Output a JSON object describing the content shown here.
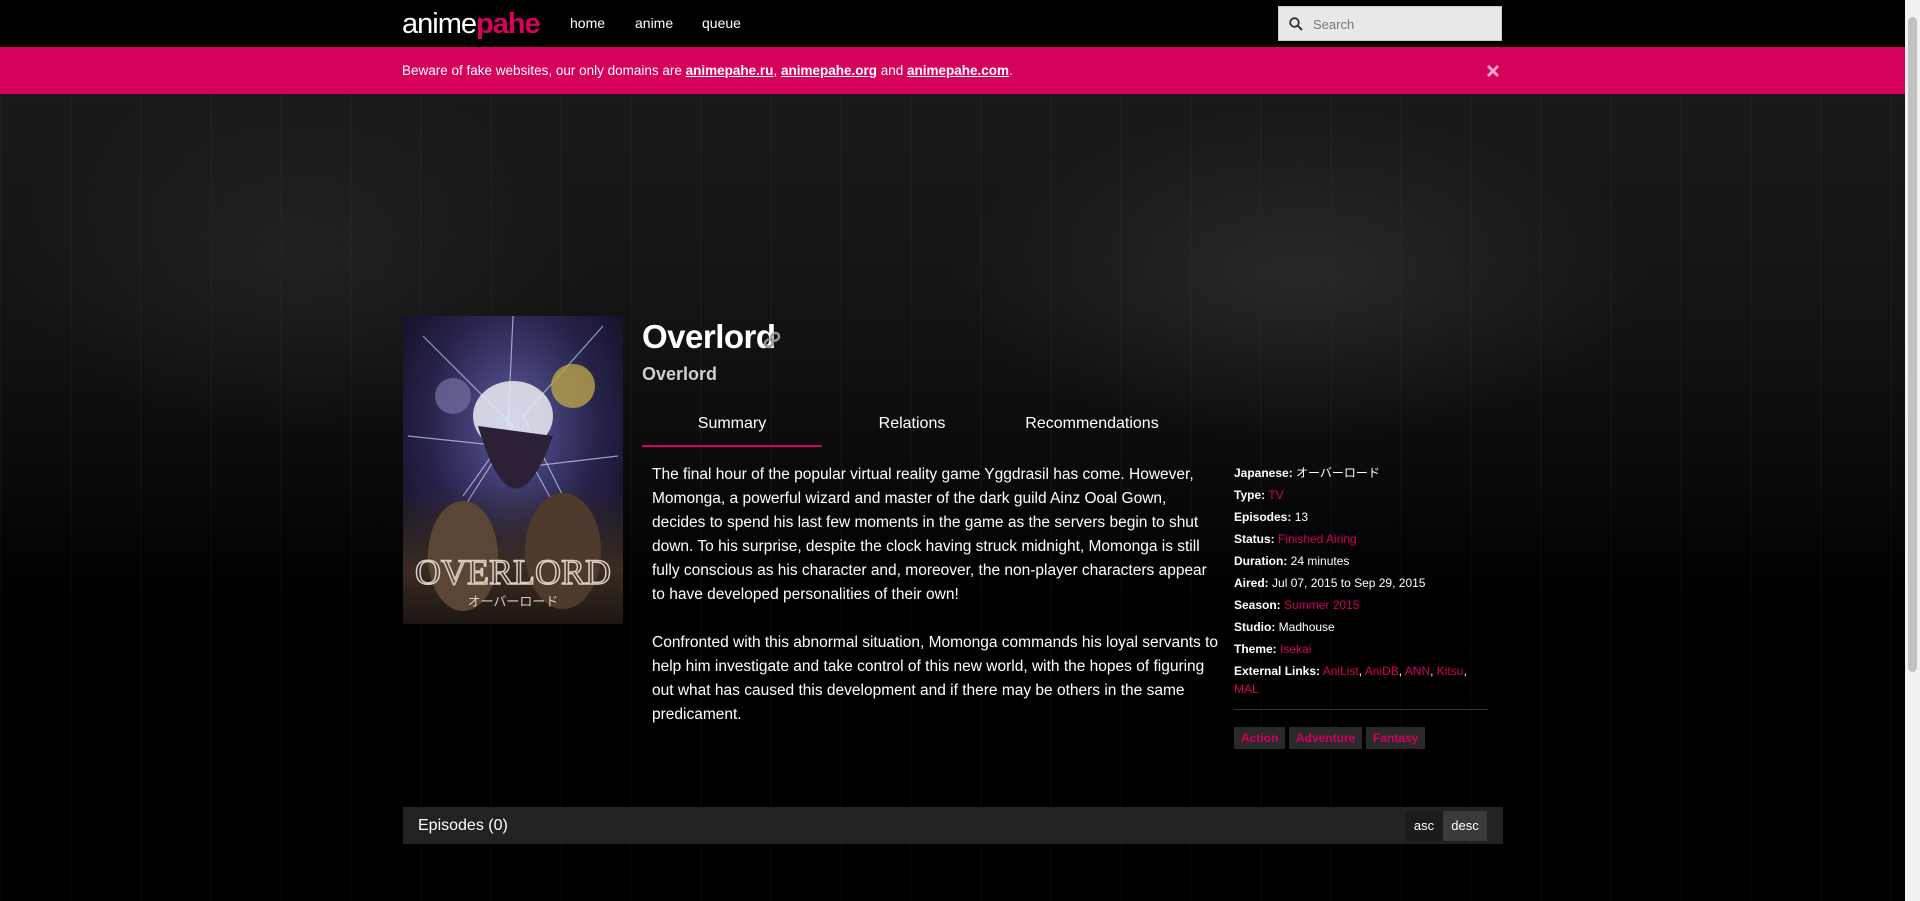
{
  "nav": {
    "logo_part1": "anime",
    "logo_part2": "pahe",
    "links": [
      "home",
      "anime",
      "queue"
    ],
    "search_placeholder": "Search"
  },
  "banner": {
    "text_before": "Beware of fake websites, our only domains are ",
    "domain1": "animepahe.ru",
    "sep1": ", ",
    "domain2": "animepahe.org",
    "sep2": " and ",
    "domain3": "animepahe.com",
    "text_after": "."
  },
  "poster": {
    "title_text": "OVERLORD",
    "subtitle_text": "オーバーロード"
  },
  "anime": {
    "title": "Overlord",
    "subtitle": "Overlord"
  },
  "tabs": [
    "Summary",
    "Relations",
    "Recommendations"
  ],
  "synopsis": [
    "The final hour of the popular virtual reality game Yggdrasil has come. However, Momonga, a powerful wizard and master of the dark guild Ainz Ooal Gown, decides to spend his last few moments in the game as the servers begin to shut down. To his surprise, despite the clock having struck midnight, Momonga is still fully conscious as his character and, moreover, the non-player characters appear to have developed personalities of their own!",
    "Confronted with this abnormal situation, Momonga commands his loyal servants to help him investigate and take control of this new world, with the hopes of figuring out what has caused this development and if there may be others in the same predicament."
  ],
  "info": {
    "japanese_label": "Japanese:",
    "japanese": "オーバーロード",
    "type_label": "Type:",
    "type": "TV",
    "episodes_label": "Episodes:",
    "episodes": "13",
    "status_label": "Status:",
    "status": "Finished Airing",
    "duration_label": "Duration:",
    "duration": "24 minutes",
    "aired_label": "Aired:",
    "aired": "Jul 07, 2015 to Sep 29, 2015",
    "season_label": "Season:",
    "season": "Summer 2015",
    "studio_label": "Studio:",
    "studio": "Madhouse",
    "theme_label": "Theme:",
    "theme": "Isekai",
    "external_label": "External Links:",
    "external_links": [
      "AniList",
      "AniDB",
      "ANN",
      "Kitsu",
      "MAL"
    ]
  },
  "genres": [
    "Action",
    "Adventure",
    "Fantasy"
  ],
  "episodes": {
    "title": "Episodes (0)",
    "sort_asc": "asc",
    "sort_desc": "desc"
  },
  "colors": {
    "accent": "#d5015b",
    "background": "#000000",
    "panel": "#222222"
  }
}
